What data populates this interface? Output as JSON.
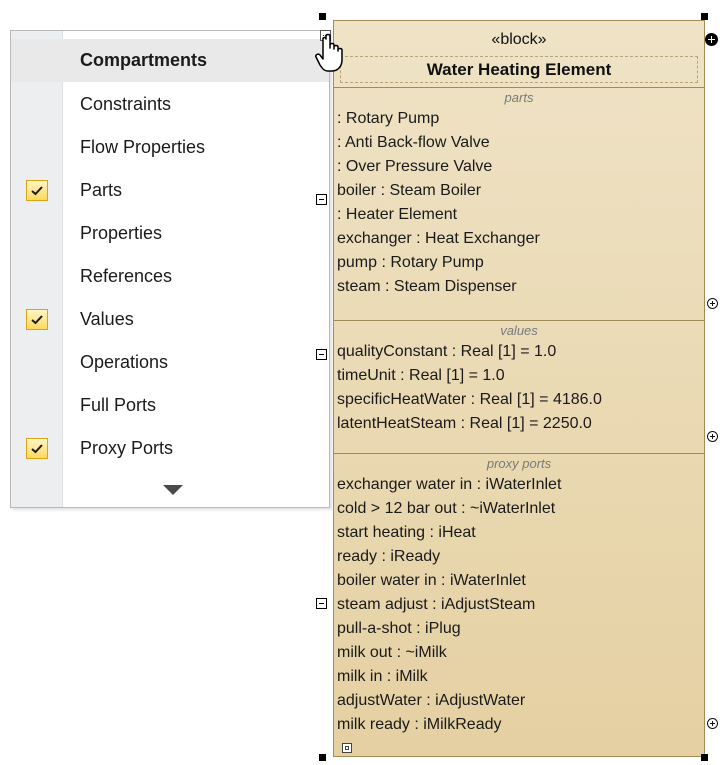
{
  "menu": {
    "header": "Compartments",
    "items": [
      {
        "label": "Constraints",
        "checked": false
      },
      {
        "label": "Flow Properties",
        "checked": false
      },
      {
        "label": "Parts",
        "checked": true
      },
      {
        "label": "Properties",
        "checked": false
      },
      {
        "label": "References",
        "checked": false
      },
      {
        "label": "Values",
        "checked": true
      },
      {
        "label": "Operations",
        "checked": false
      },
      {
        "label": "Full Ports",
        "checked": false
      },
      {
        "label": "Proxy Ports",
        "checked": true
      }
    ],
    "scroll_icon": "triangle-down-icon"
  },
  "block": {
    "stereotype": "«block»",
    "name": "Water Heating Element",
    "compartments": [
      {
        "title": "parts",
        "rows": [
          ": Rotary Pump",
          ": Anti Back-flow Valve",
          ": Over Pressure Valve",
          "boiler : Steam Boiler",
          ": Heater Element",
          "exchanger : Heat Exchanger",
          "pump : Rotary Pump",
          "steam : Steam Dispenser"
        ]
      },
      {
        "title": "values",
        "rows": [
          "qualityConstant : Real [1] = 1.0",
          "timeUnit : Real [1] = 1.0",
          "specificHeatWater : Real [1] = 4186.0",
          "latentHeatSteam : Real [1] = 2250.0"
        ]
      },
      {
        "title": "proxy ports",
        "rows": [
          "exchanger water in : iWaterInlet",
          "cold > 12 bar out : ~iWaterInlet",
          "start heating : iHeat",
          "ready : iReady",
          "boiler water in : iWaterInlet",
          "steam adjust : iAdjustSteam",
          "pull-a-shot : iPlug",
          "milk out : ~iMilk",
          "milk in : iMilk",
          "adjustWater : iAdjustWater",
          "milk ready : iMilkReady"
        ]
      }
    ]
  },
  "colors": {
    "block_fill_top": "#efe3c6",
    "block_fill_bottom": "#e5d0a2",
    "block_border": "#a28b57",
    "check_fill": "#ffd85e"
  }
}
